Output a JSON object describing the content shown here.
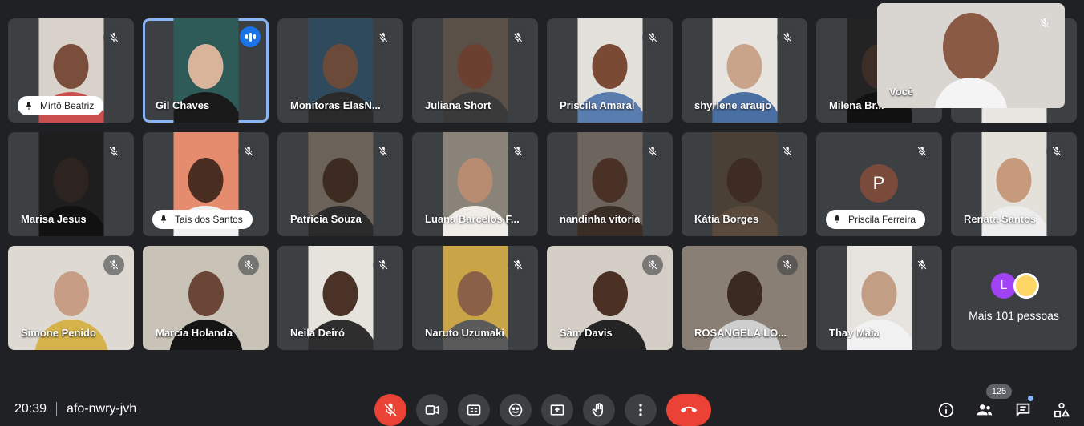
{
  "participants": [
    {
      "name": "Mirtô Beatriz",
      "style": "pill"
    },
    {
      "name": "Gil Chaves",
      "style": "label",
      "speaking": true
    },
    {
      "name": "Monitoras ElasN...",
      "style": "label"
    },
    {
      "name": "Juliana Short",
      "style": "label"
    },
    {
      "name": "Priscila Amaral",
      "style": "label"
    },
    {
      "name": "shyrlene araujo",
      "style": "label"
    },
    {
      "name": "Milena Br...",
      "style": "label"
    },
    {
      "name": "",
      "style": "label"
    },
    {
      "name": "Marisa Jesus",
      "style": "label"
    },
    {
      "name": "Tais dos Santos",
      "style": "pill"
    },
    {
      "name": "Patricia Souza",
      "style": "label"
    },
    {
      "name": "Luana Barcelos F...",
      "style": "label"
    },
    {
      "name": "nandinha vitoria",
      "style": "label"
    },
    {
      "name": "Kátia Borges",
      "style": "label"
    },
    {
      "name": "Priscila Ferreira",
      "style": "pill",
      "avatar_letter": "P"
    },
    {
      "name": "Renata Santos",
      "style": "label"
    },
    {
      "name": "Simone Penido",
      "style": "label"
    },
    {
      "name": "Marcia Holanda",
      "style": "label"
    },
    {
      "name": "Neila Deiró",
      "style": "label"
    },
    {
      "name": "Naruto Uzumaki",
      "style": "label"
    },
    {
      "name": "Sâm Davis",
      "style": "label"
    },
    {
      "name": "ROSANGELA LO...",
      "style": "label"
    },
    {
      "name": "Thay Maia",
      "style": "label"
    }
  ],
  "more": {
    "label": "Mais 101 pessoas",
    "avatar_letter": "L"
  },
  "self_view": {
    "label": "Você"
  },
  "footer": {
    "time": "20:39",
    "meeting_code": "afo-nwry-jvh",
    "participant_count": "125"
  },
  "colors": {
    "background": "#202124",
    "tile": "#3c4043",
    "mic_off": "#ea4335",
    "speaking": "#1a73e8"
  },
  "icons": [
    "mic-off-icon",
    "camera-icon",
    "captions-icon",
    "emoji-icon",
    "present-icon",
    "raise-hand-icon",
    "more-options-icon",
    "end-call-icon",
    "info-icon",
    "people-icon",
    "chat-icon",
    "activities-icon"
  ]
}
